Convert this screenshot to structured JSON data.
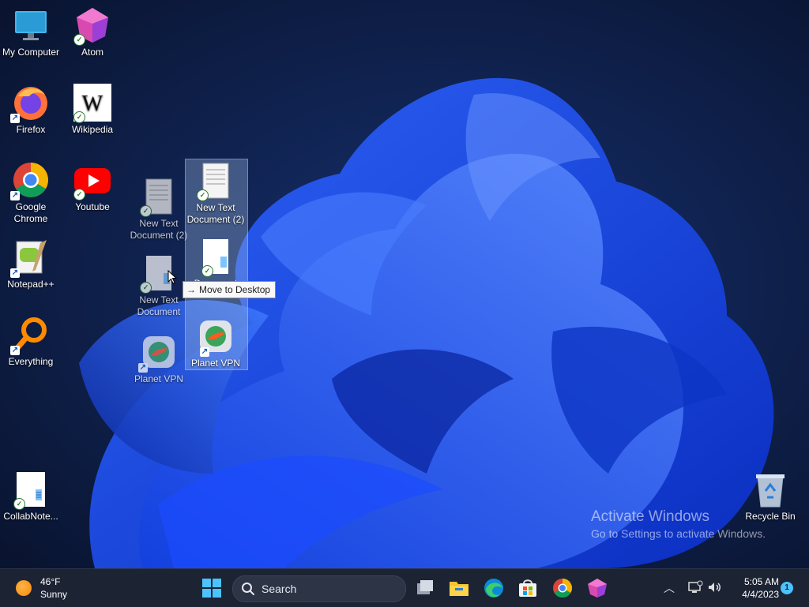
{
  "desktop": {
    "icons": {
      "my_computer": "My Computer",
      "atom": "Atom",
      "firefox": "Firefox",
      "wikipedia": "Wikipedia",
      "chrome": "Google\nChrome",
      "youtube": "Youtube",
      "notepadpp": "Notepad++",
      "everything": "Everything",
      "collabnote": "CollabNote...",
      "recycle_bin": "Recycle Bin",
      "ghost_new_text_doc_2": "New Text Document (2)",
      "ghost_new_text_doc": "New Text Document",
      "ghost_planet_vpn": "Planet VPN",
      "drag_new_text_doc_2": "New Text Document (2)",
      "drag_new_text_doc": "Document",
      "drag_planet_vpn": "Planet VPN"
    },
    "drag_tooltip": "Move to Desktop",
    "watermark": {
      "line1": "Activate Windows",
      "line2": "Go to Settings to activate Windows."
    }
  },
  "taskbar": {
    "weather": {
      "temp": "46°F",
      "condition": "Sunny"
    },
    "search_label": "Search",
    "apps": [
      "task-view-icon",
      "file-explorer-icon",
      "edge-icon",
      "store-icon",
      "chrome-icon",
      "atom-icon"
    ],
    "tray": {
      "time": "5:05 AM",
      "date": "4/4/2023",
      "notification_count": "1"
    }
  },
  "colors": {
    "accent": "#1f5fff",
    "taskbar_bg": "#1c2333",
    "desktop_bg": "#0a1530"
  }
}
